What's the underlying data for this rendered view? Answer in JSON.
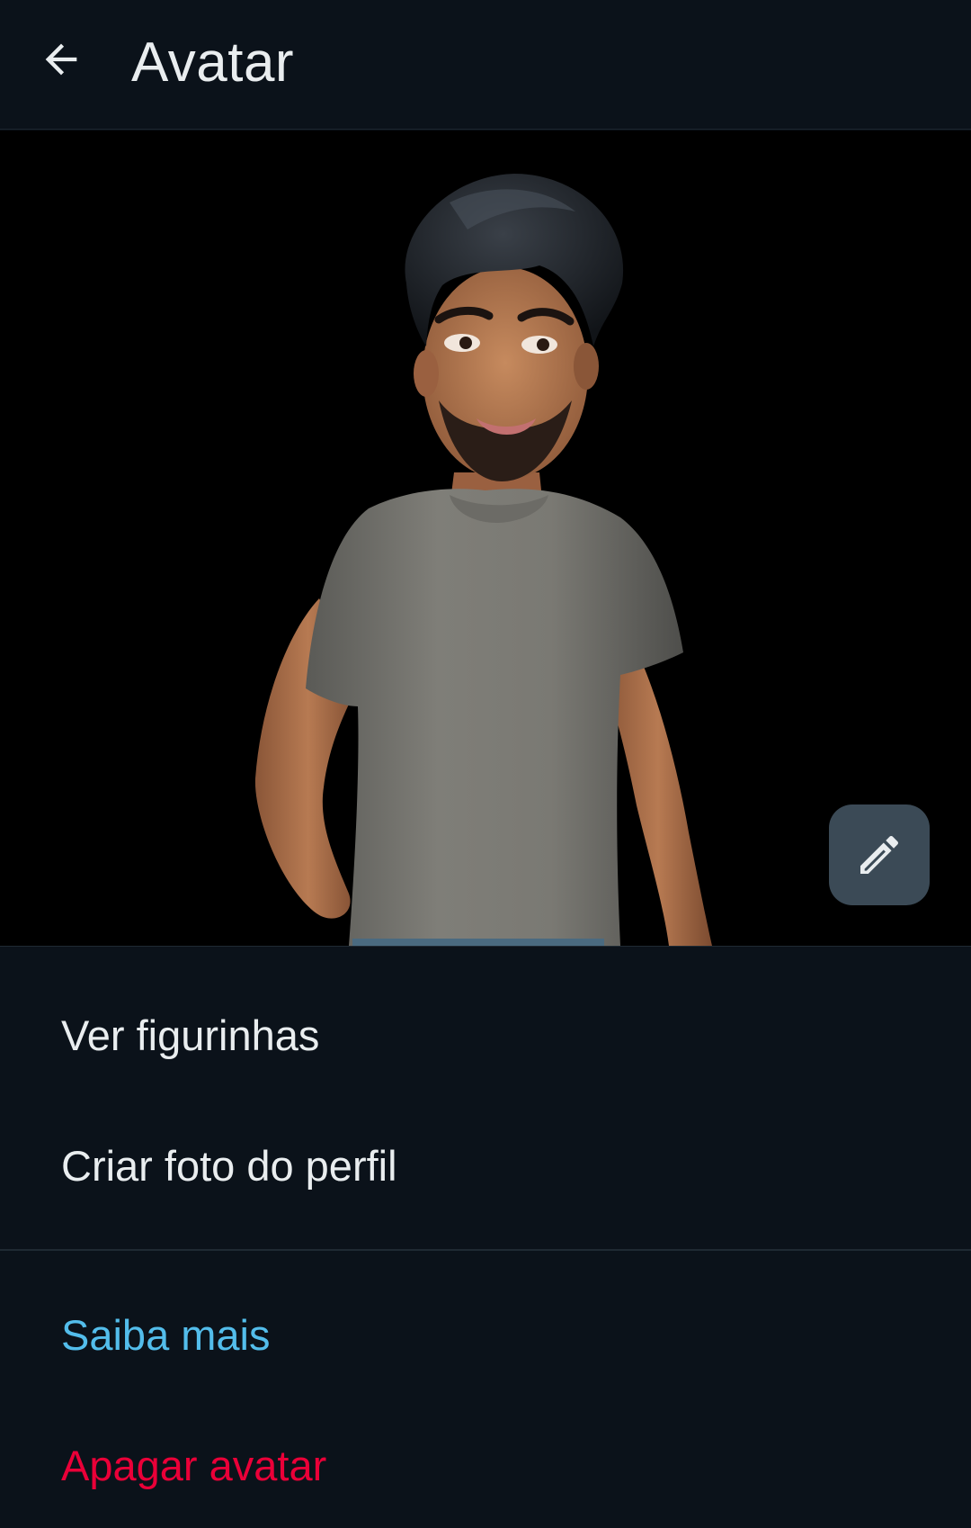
{
  "app_bar": {
    "title": "Avatar",
    "back_icon": "arrow-left-icon"
  },
  "preview": {
    "edit_icon": "pencil-icon"
  },
  "menu": {
    "stickers_label": "Ver figurinhas",
    "profile_photo_label": "Criar foto do perfil",
    "learn_more_label": "Saiba mais",
    "delete_label": "Apagar avatar"
  },
  "colors": {
    "background": "#0b121a",
    "text_primary": "#e9edef",
    "link": "#53bdeb",
    "danger": "#ea0038",
    "edit_button": "#3b4a56"
  }
}
